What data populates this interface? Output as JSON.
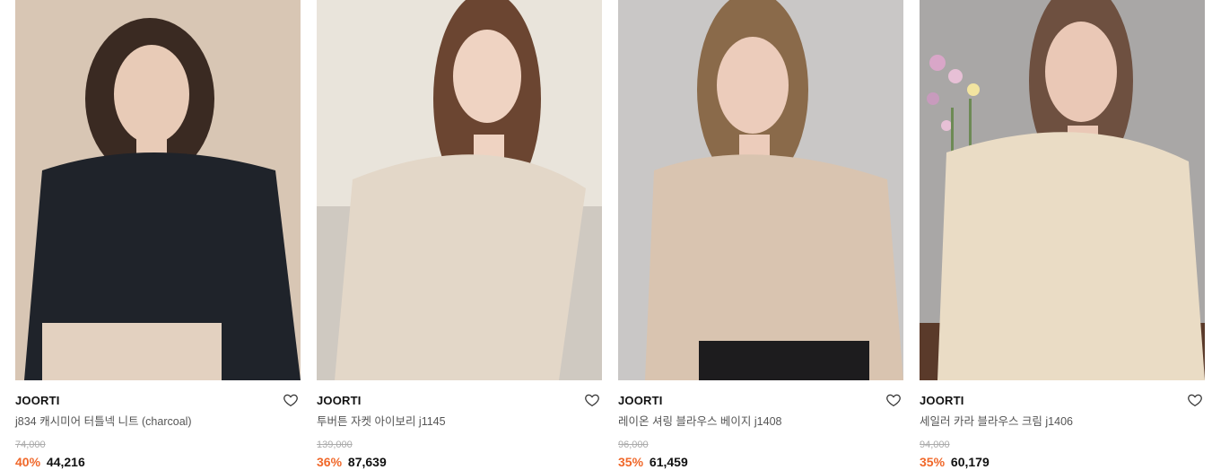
{
  "products": [
    {
      "brand": "JOORTI",
      "name": "j834 캐시미어 터틀넥 니트 (charcoal)",
      "original_price": "74,000",
      "discount": "40%",
      "price": "44,216",
      "image_icon": "product-photo",
      "colors": {
        "bg": "#d8c6b4",
        "top": "#1f232a",
        "bottom": "#e3d1c0",
        "skin": "#e8cbb7",
        "hair": "#3a2a22"
      }
    },
    {
      "brand": "JOORTI",
      "name": "투버튼 자켓 아이보리 j1145",
      "original_price": "139,000",
      "discount": "36%",
      "price": "87,639",
      "image_icon": "product-photo",
      "colors": {
        "bg": "#e9e4db",
        "top": "#e3d7c8",
        "bottom": "#cfc9c1",
        "skin": "#efd3c2",
        "hair": "#6b4531"
      }
    },
    {
      "brand": "JOORTI",
      "name": "레이온 셔링 블라우스 베이지 j1408",
      "original_price": "96,000",
      "discount": "35%",
      "price": "61,459",
      "image_icon": "product-photo",
      "colors": {
        "bg": "#c9c7c6",
        "top": "#d9c4b0",
        "bottom": "#1d1c1e",
        "skin": "#ecccbb",
        "hair": "#8a6a4a"
      }
    },
    {
      "brand": "JOORTI",
      "name": "세일러 카라 블라우스 크림 j1406",
      "original_price": "94,000",
      "discount": "35%",
      "price": "60,179",
      "image_icon": "product-photo",
      "colors": {
        "bg": "#a9a7a6",
        "top": "#eadcc5",
        "bottom": "#5a3a2a",
        "skin": "#eac8b6",
        "hair": "#6e5040"
      }
    }
  ],
  "icons": {
    "wishlist": "heart-outline-icon"
  },
  "accent_color": "#f0682a"
}
